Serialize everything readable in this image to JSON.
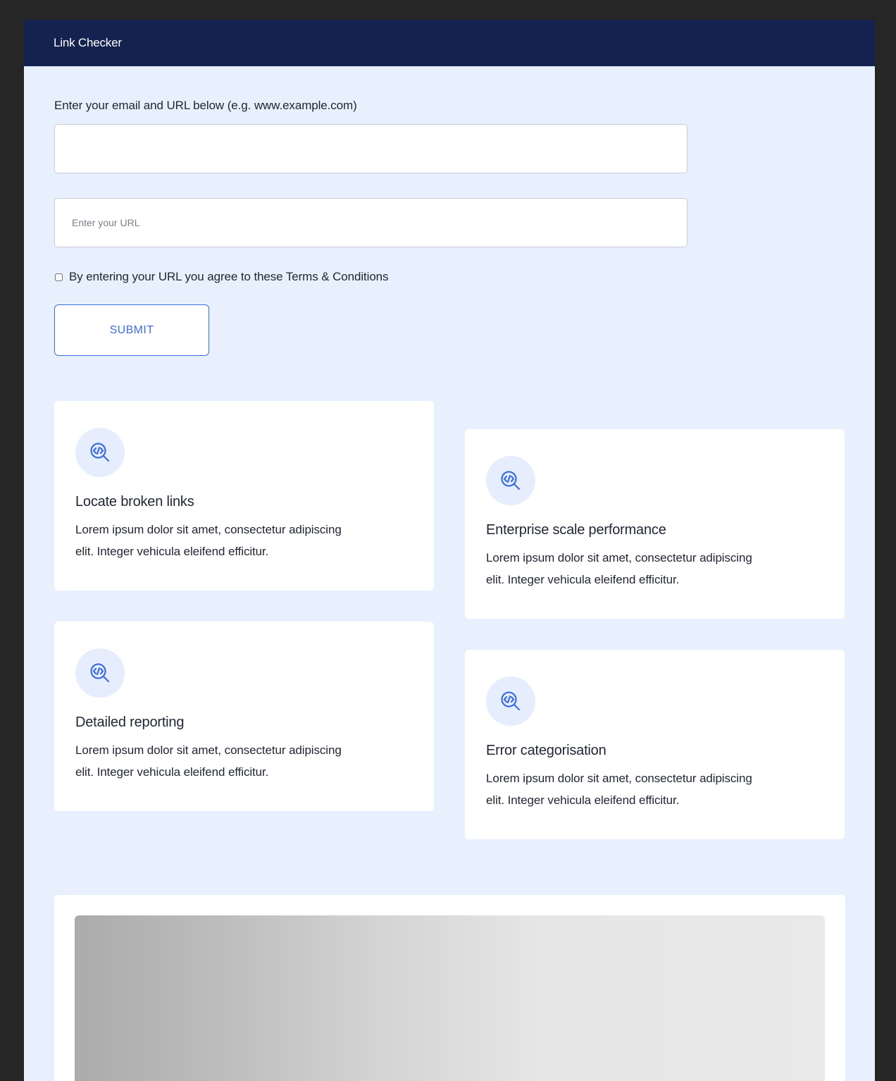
{
  "header": {
    "brand": "Link Checker"
  },
  "form": {
    "instruction": "Enter your email and URL below (e.g. www.example.com)",
    "email_value": "",
    "url_placeholder": "Enter your URL",
    "terms_label": "By entering your URL you agree to these Terms & Conditions",
    "submit_label": "SUBMIT"
  },
  "features": [
    {
      "icon": "code-search-icon",
      "title": "Locate broken links",
      "text": "Lorem ipsum dolor sit amet, consectetur adipiscing elit. Integer vehicula eleifend efficitur."
    },
    {
      "icon": "code-search-icon",
      "title": "Enterprise scale performance",
      "text": "Lorem ipsum dolor sit amet, consectetur adipiscing elit. Integer vehicula eleifend efficitur."
    },
    {
      "icon": "code-search-icon",
      "title": "Detailed reporting",
      "text": "Lorem ipsum dolor sit amet, consectetur adipiscing elit. Integer vehicula eleifend efficitur."
    },
    {
      "icon": "code-search-icon",
      "title": "Error categorisation",
      "text": "Lorem ipsum dolor sit amet, consectetur adipiscing elit. Integer vehicula eleifend efficitur."
    }
  ],
  "colors": {
    "header_bg": "#14224f",
    "page_bg": "#e9f0fd",
    "accent": "#3c6ee0",
    "icon_bg": "#e6eefd"
  }
}
